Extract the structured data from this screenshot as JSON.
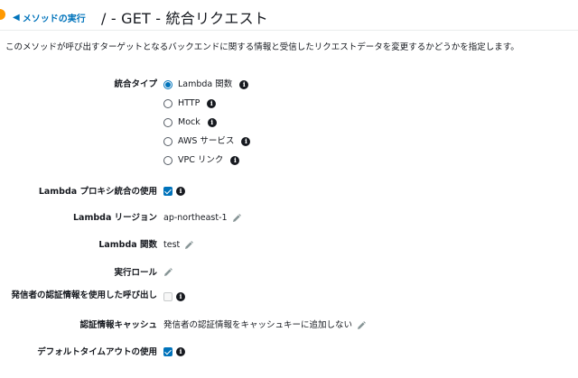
{
  "header": {
    "back_label": "メソッドの実行",
    "title": "/ - GET - 統合リクエスト"
  },
  "description": "このメソッドが呼び出すターゲットとなるバックエンドに関する情報と受信したリクエストデータを変更するかどうかを指定します。",
  "integration_type": {
    "label": "統合タイプ",
    "selected": "Lambda 関数",
    "options": [
      {
        "label": "Lambda 関数"
      },
      {
        "label": "HTTP"
      },
      {
        "label": "Mock"
      },
      {
        "label": "AWS サービス"
      },
      {
        "label": "VPC リンク"
      }
    ]
  },
  "lambda_proxy": {
    "label": "Lambda プロキシ統合の使用",
    "checked": true
  },
  "lambda_region": {
    "label": "Lambda リージョン",
    "value": "ap-northeast-1"
  },
  "lambda_function": {
    "label": "Lambda 関数",
    "value": "test"
  },
  "execution_role": {
    "label": "実行ロール",
    "value": ""
  },
  "invoke_with_caller_credentials": {
    "label": "発信者の認証情報を使用した呼び出し",
    "checked": false
  },
  "credentials_cache": {
    "label": "認証情報キャッシュ",
    "value": "発信者の認証情報をキャッシュキーに追加しない"
  },
  "default_timeout": {
    "label": "デフォルトタイムアウトの使用",
    "checked": true
  },
  "colors": {
    "link": "#0073bb",
    "accent": "#ff9900",
    "text": "#16191f"
  }
}
